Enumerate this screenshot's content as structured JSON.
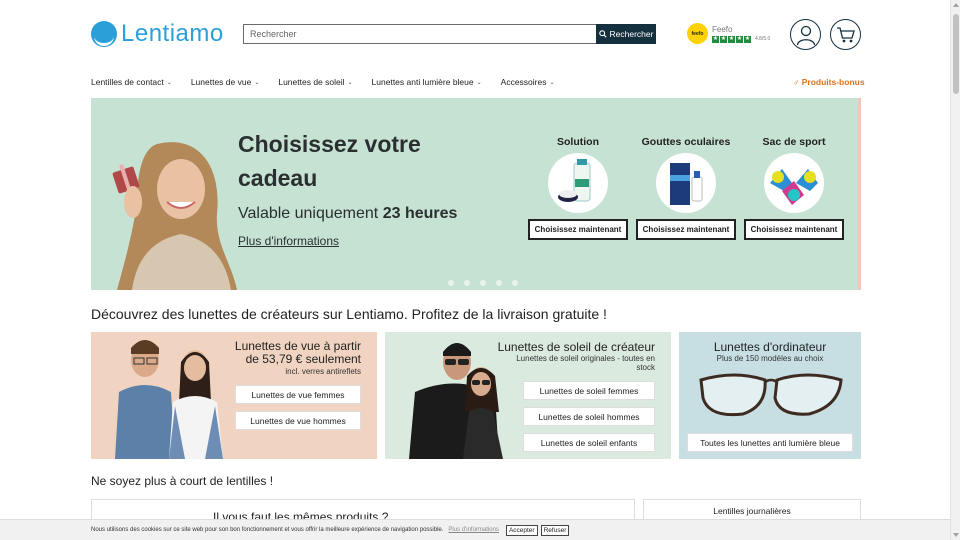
{
  "header": {
    "logo_text": "Lentiamo",
    "search_placeholder": "Rechercher",
    "search_button": "Rechercher",
    "feefo_badge": "feefo",
    "feefo_name": "Feefo",
    "feefo_score": "4.8/5.0",
    "accent_color": "#2a9fd8",
    "dark_color": "#14303f"
  },
  "nav": {
    "items": [
      {
        "label": "Lentilles de contact"
      },
      {
        "label": "Lunettes de vue"
      },
      {
        "label": "Lunettes de soleil"
      },
      {
        "label": "Lunettes anti lumière bleue"
      },
      {
        "label": "Accessoires"
      }
    ],
    "bonus_label": "Produits-bonus",
    "bonus_color": "#d9731b"
  },
  "hero": {
    "title": "Choisissez votre cadeau",
    "subtitle_prefix": "Valable uniquement",
    "subtitle_bold": "23 heures",
    "link": "Plus d'informations",
    "background": "#c6e2d3",
    "gifts": [
      {
        "title": "Solution",
        "button": "Choisissez maintenant"
      },
      {
        "title": "Gouttes oculaires",
        "button": "Choisissez maintenant"
      },
      {
        "title": "Sac de sport",
        "button": "Choisissez maintenant"
      }
    ],
    "slide_count": 5
  },
  "designer_section": {
    "title": "Découvrez des lunettes de créateurs sur Lentiamo. Profitez de la livraison gratuite !",
    "cards": [
      {
        "title": "Lunettes de vue à partir de 53,79 € seulement",
        "sub": "incl. verres antireflets",
        "buttons": [
          "Lunettes de vue femmes",
          "Lunettes de vue hommes"
        ]
      },
      {
        "title": "Lunettes de soleil de créateur",
        "sub": "Lunettes de soleil originales - toutes en stock",
        "buttons": [
          "Lunettes de soleil femmes",
          "Lunettes de soleil hommes",
          "Lunettes de soleil enfants"
        ]
      },
      {
        "title": "Lunettes d'ordinateur",
        "sub": "Plus de 150 modèles au choix",
        "buttons": [
          "Toutes les lunettes anti lumière bleue"
        ]
      }
    ]
  },
  "lenses_section": {
    "title": "Ne soyez plus à court de lentilles !",
    "box_title": "Il vous faut les mêmes produits ?",
    "side_label": "Lentilles journalières"
  },
  "cookie": {
    "text": "Nous utilisons des cookies sur ce site web pour son bon fonctionnement et vous offrir la meilleure expérience de navigation possible.",
    "link": "Plus d'informations",
    "accept": "Accepter",
    "refuse": "Refuser"
  }
}
